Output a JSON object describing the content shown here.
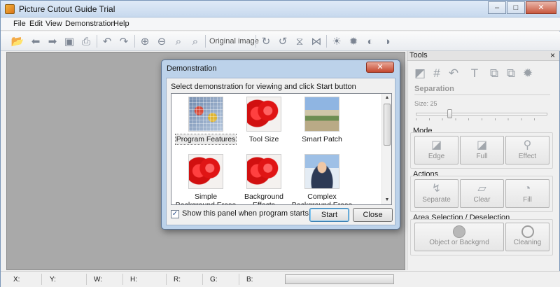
{
  "window": {
    "title": "Picture Cutout Guide Trial",
    "minimize": "–",
    "maximize": "□",
    "close": "✕"
  },
  "menu": [
    "File",
    "Edit",
    "View",
    "Demonstration",
    "Help"
  ],
  "toolbar": {
    "original_image_label": "Original image"
  },
  "tools_panel": {
    "title": "Tools",
    "close": "×",
    "separation": {
      "title": "Separation",
      "size_label": "Size: 25",
      "size_value": 25
    },
    "mode": {
      "title": "Mode",
      "buttons": [
        "Edge",
        "Full",
        "Effect"
      ]
    },
    "actions": {
      "title": "Actions",
      "buttons": [
        "Separate",
        "Clear",
        "Fill"
      ]
    },
    "area": {
      "title": "Area Selection / Deselection",
      "buttons": [
        "Object or Backgrnd",
        "Cleaning"
      ]
    }
  },
  "status": {
    "x": "X:",
    "y": "Y:",
    "w": "W:",
    "h": "H:",
    "r": "R:",
    "g": "G:",
    "b": "B:"
  },
  "dialog": {
    "title": "Demonstration",
    "close": "✕",
    "message": "Select demonstration for viewing and click Start button",
    "items": [
      {
        "label": "Program Features",
        "selected": true
      },
      {
        "label": "Tool Size"
      },
      {
        "label": "Smart Patch"
      },
      {
        "label": "Simple Background Erase"
      },
      {
        "label": "Background Effects"
      },
      {
        "label": "Complex Background Erase"
      }
    ],
    "checkbox_label": "Show this panel when program starts",
    "checkbox_checked": true,
    "start": "Start",
    "close_button": "Close"
  }
}
